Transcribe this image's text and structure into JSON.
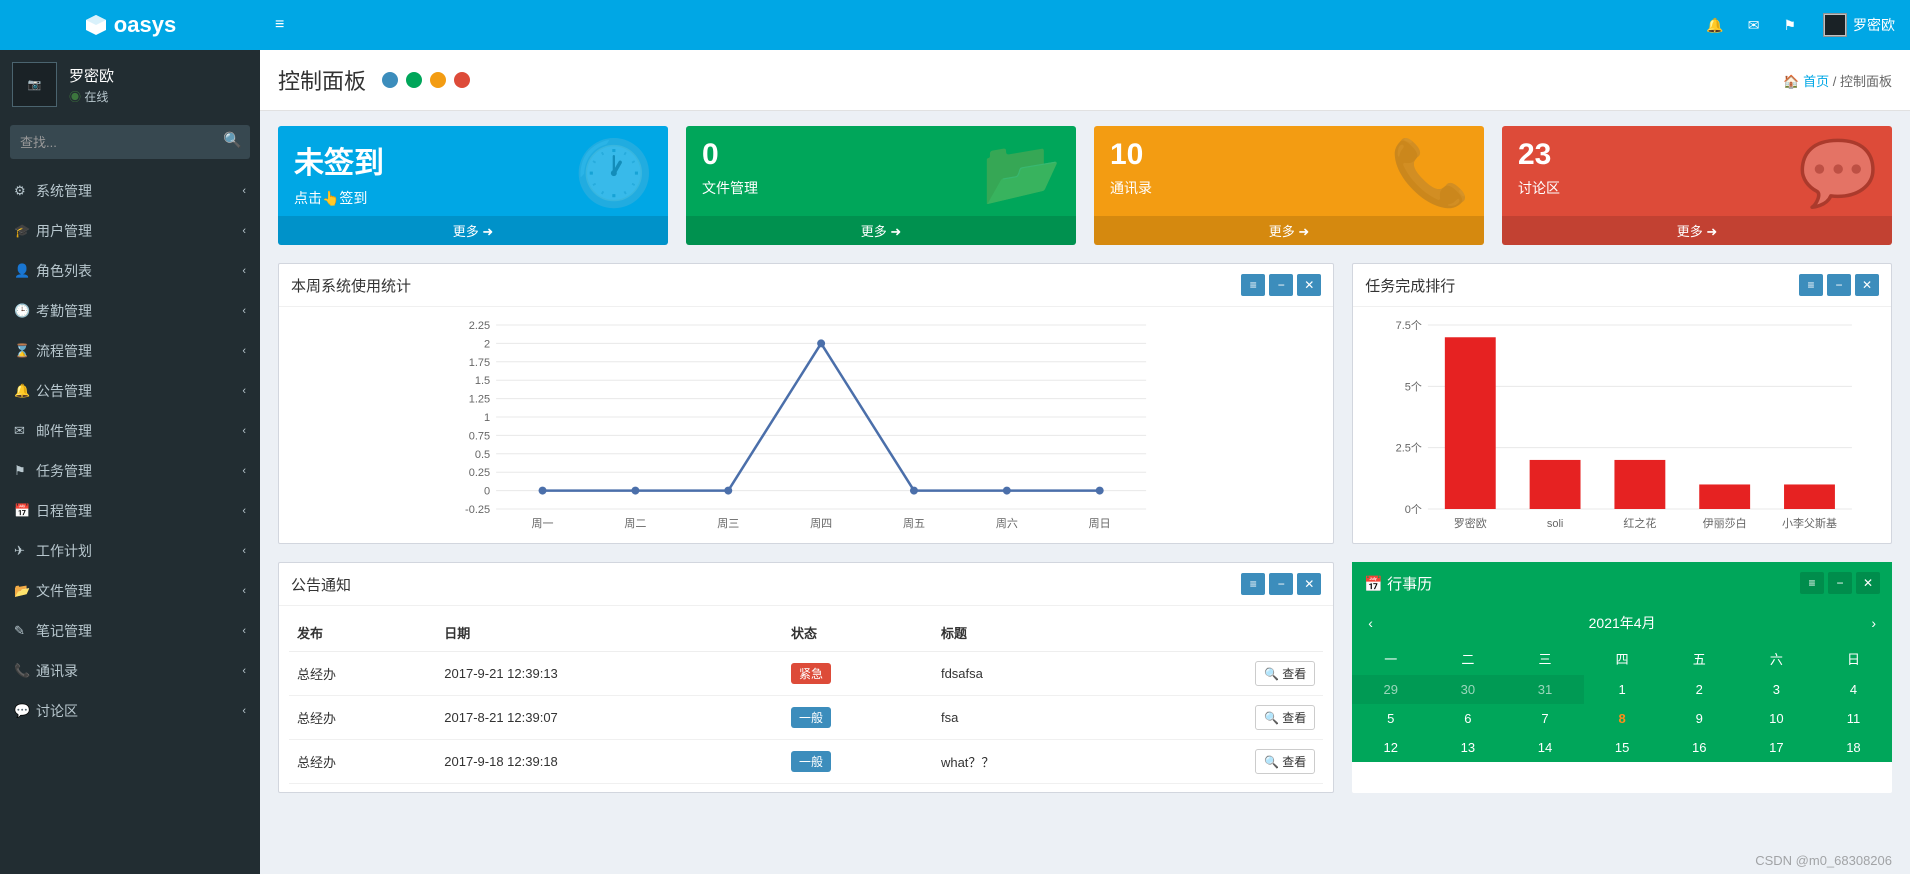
{
  "brand": "oasys",
  "user": {
    "name": "罗密欧",
    "status": "在线"
  },
  "search_placeholder": "查找...",
  "menu": [
    {
      "icon": "⚙",
      "label": "系统管理"
    },
    {
      "icon": "🎓",
      "label": "用户管理"
    },
    {
      "icon": "👤",
      "label": "角色列表"
    },
    {
      "icon": "🕒",
      "label": "考勤管理"
    },
    {
      "icon": "⌛",
      "label": "流程管理"
    },
    {
      "icon": "🔔",
      "label": "公告管理"
    },
    {
      "icon": "✉",
      "label": "邮件管理"
    },
    {
      "icon": "⚑",
      "label": "任务管理"
    },
    {
      "icon": "📅",
      "label": "日程管理"
    },
    {
      "icon": "✈",
      "label": "工作计划"
    },
    {
      "icon": "📂",
      "label": "文件管理"
    },
    {
      "icon": "✎",
      "label": "笔记管理"
    },
    {
      "icon": "📞",
      "label": "通讯录"
    },
    {
      "icon": "💬",
      "label": "讨论区"
    }
  ],
  "page": {
    "title": "控制面板",
    "home": "首页",
    "crumb": "控制面板"
  },
  "dot_colors": [
    "#3c8dbc",
    "#00a65a",
    "#f39c12",
    "#dd4b39"
  ],
  "cards": [
    {
      "title": "未签到",
      "sub": "点击👆签到",
      "more": "更多",
      "icon": "clock"
    },
    {
      "title": "0",
      "sub": "文件管理",
      "more": "更多",
      "icon": "folder"
    },
    {
      "title": "10",
      "sub": "通讯录",
      "more": "更多",
      "icon": "phone"
    },
    {
      "title": "23",
      "sub": "讨论区",
      "more": "更多",
      "icon": "chat"
    }
  ],
  "chart1_title": "本周系统使用统计",
  "chart2_title": "任务完成排行",
  "ann_title": "公告通知",
  "ann_cols": {
    "pub": "发布",
    "date": "日期",
    "status": "状态",
    "title": "标题"
  },
  "view_label": "查看",
  "announcements": [
    {
      "pub": "总经办",
      "date": "2017-9-21 12:39:13",
      "status": "紧急",
      "status_cls": "tag-red",
      "title": "fdsafsa"
    },
    {
      "pub": "总经办",
      "date": "2017-8-21 12:39:07",
      "status": "一般",
      "status_cls": "tag-blue",
      "title": "fsa"
    },
    {
      "pub": "总经办",
      "date": "2017-9-18 12:39:18",
      "status": "一般",
      "status_cls": "tag-blue",
      "title": "what？？"
    }
  ],
  "calendar": {
    "title": "行事历",
    "month": "2021年4月",
    "weekdays": [
      "一",
      "二",
      "三",
      "四",
      "五",
      "六",
      "日"
    ],
    "rows": [
      [
        {
          "d": 29,
          "dim": true
        },
        {
          "d": 30,
          "dim": true
        },
        {
          "d": 31,
          "dim": true
        },
        {
          "d": 1
        },
        {
          "d": 2
        },
        {
          "d": 3
        },
        {
          "d": 4
        }
      ],
      [
        {
          "d": 5
        },
        {
          "d": 6
        },
        {
          "d": 7
        },
        {
          "d": 8,
          "today": true
        },
        {
          "d": 9
        },
        {
          "d": 10
        },
        {
          "d": 11
        }
      ],
      [
        {
          "d": 12
        },
        {
          "d": 13
        },
        {
          "d": 14
        },
        {
          "d": 15
        },
        {
          "d": 16
        },
        {
          "d": 17
        },
        {
          "d": 18
        }
      ]
    ]
  },
  "watermark": "CSDN @m0_68308206",
  "chart_data": [
    {
      "type": "line",
      "title": "本周系统使用统计",
      "categories": [
        "周一",
        "周二",
        "周三",
        "周四",
        "周五",
        "周六",
        "周日"
      ],
      "values": [
        0,
        0,
        0,
        2,
        0,
        0,
        0
      ],
      "ylim": [
        -0.25,
        2.25
      ],
      "yticks": [
        -0.25,
        0,
        0.25,
        0.5,
        0.75,
        1,
        1.25,
        1.5,
        1.75,
        2,
        2.25
      ]
    },
    {
      "type": "bar",
      "title": "任务完成排行",
      "categories": [
        "罗密欧",
        "soli",
        "红之花",
        "伊丽莎白",
        "小李父斯基"
      ],
      "values": [
        7,
        2,
        2,
        1,
        1
      ],
      "ylabel_suffix": "个",
      "ylim": [
        0,
        7.5
      ],
      "yticks": [
        0,
        2.5,
        5,
        7.5
      ]
    }
  ]
}
